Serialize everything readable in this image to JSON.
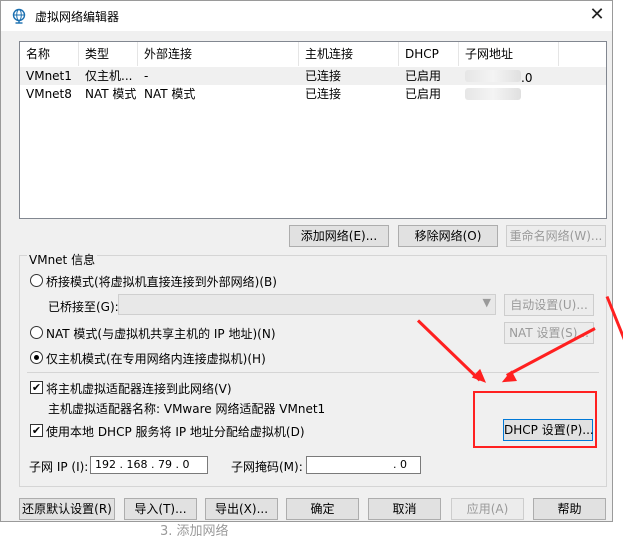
{
  "window": {
    "title": "虚拟网络编辑器",
    "close_glyph": "✕"
  },
  "table": {
    "headers": [
      "名称",
      "类型",
      "外部连接",
      "主机连接",
      "DHCP",
      "子网地址"
    ],
    "rows": [
      {
        "name": "VMnet1",
        "type": "仅主机...",
        "external": "-",
        "host": "已连接",
        "dhcp": "已启用",
        "subnet": ".0"
      },
      {
        "name": "VMnet8",
        "type": "NAT 模式",
        "external": "NAT 模式",
        "host": "已连接",
        "dhcp": "已启用",
        "subnet": ""
      }
    ]
  },
  "list_buttons": {
    "add": "添加网络(E)...",
    "remove": "移除网络(O)",
    "rename": "重命名网络(W)..."
  },
  "vmnet_info": {
    "group_label": "VMnet 信息",
    "bridged": "桥接模式(将虚拟机直接连接到外部网络)(B)",
    "bridged_to_label": "已桥接至(G):",
    "auto_settings": "自动设置(U)...",
    "nat": "NAT 模式(与虚拟机共享主机的 IP 地址)(N)",
    "nat_settings": "NAT 设置(S)...",
    "host_only": "仅主机模式(在专用网络内连接虚拟机)(H)",
    "connect_adapter": "将主机虚拟适配器连接到此网络(V)",
    "adapter_name": "主机虚拟适配器名称: VMware 网络适配器 VMnet1",
    "use_dhcp": "使用本地 DHCP 服务将 IP 地址分配给虚拟机(D)",
    "dhcp_settings": "DHCP 设置(P)...",
    "subnet_ip_label": "子网 IP (I):",
    "subnet_ip_value": "192 . 168 . 79 . 0",
    "subnet_mask_label": "子网掩码(M):",
    "subnet_mask_value": ". 0"
  },
  "footer": {
    "restore": "还原默认设置(R)",
    "import": "导入(T)...",
    "export": "导出(X)...",
    "ok": "确定",
    "cancel": "取消",
    "apply": "应用(A)",
    "help": "帮助"
  },
  "background": {
    "step_text": "3. 添加网络"
  },
  "colors": {
    "annotation": "#ff2020",
    "focus": "#0078d7"
  },
  "icons": {
    "title": "network-globe-icon",
    "dropdown": "chevron-down-icon"
  }
}
